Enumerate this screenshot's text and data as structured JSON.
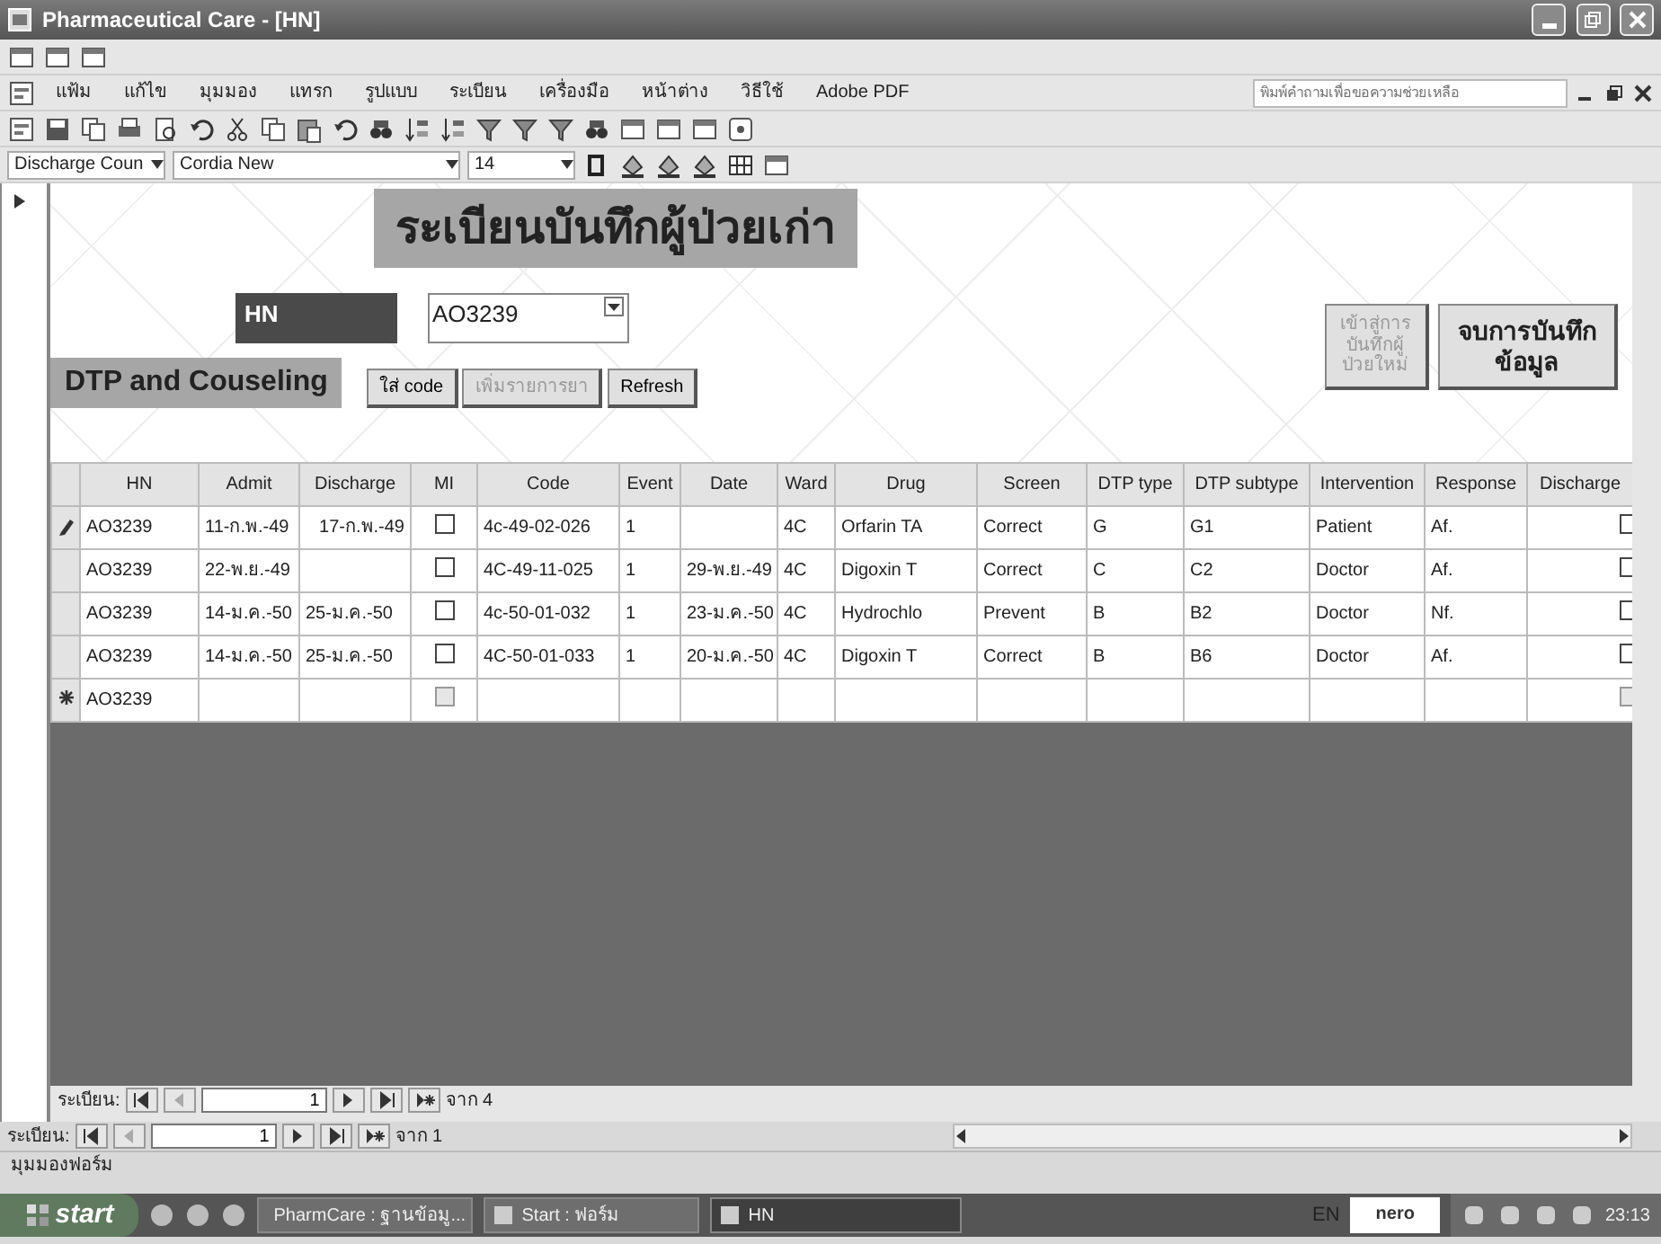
{
  "window": {
    "title": "Pharmaceutical Care - [HN]"
  },
  "menu_bar": {
    "items": [
      "แฟ้ม",
      "แก้ไข",
      "มุมมอง",
      "แทรก",
      "รูปแบบ",
      "ระเบียน",
      "เครื่องมือ",
      "หน้าต่าง",
      "วิธีใช้",
      "Adobe PDF"
    ],
    "help_box": {
      "placeholder": "พิมพ์คำถามเพื่อขอความช่วยเหลือ"
    }
  },
  "format_toolbar": {
    "object_combo": "Discharge Coun",
    "font_combo": "Cordia New",
    "size_combo": "14"
  },
  "form": {
    "title": "ระเบียนบันทึกผู้ป่วยเก่า",
    "hn_label": "HN",
    "hn_value": "AO3239",
    "section_title": "DTP and Couseling",
    "buttons": [
      {
        "label": "ใส่ code",
        "disabled": false
      },
      {
        "label": "เพิ่มรายการยา",
        "disabled": true
      },
      {
        "label": "Refresh",
        "disabled": false
      }
    ],
    "side_buttons": [
      {
        "label": "เข้าสู่การบันทึกผู้ป่วยใหม่",
        "disabled": true
      },
      {
        "label": "จบการบันทึกข้อมูล",
        "disabled": false
      }
    ],
    "table": {
      "columns": [
        "HN",
        "Admit",
        "Discharge",
        "MI",
        "Code",
        "Event",
        "Date",
        "Ward",
        "Drug",
        "Screen",
        "DTP type",
        "DTP subtype",
        "Intervention",
        "Response",
        "Discharge"
      ],
      "rows": [
        {
          "kind": "editing",
          "cells": [
            "AO3239",
            "11-ก.พ.-49",
            "17-ก.พ.-49",
            {
              "checked": false,
              "disabled": false
            },
            "4c-49-02-026",
            "1",
            null,
            "4C",
            "Orfarin TA",
            "Correct",
            "G",
            "G1",
            "Patient",
            "Af.",
            {
              "checked": false,
              "disabled": false
            }
          ]
        },
        {
          "kind": "plain",
          "cells": [
            "AO3239",
            "22-พ.ย.-49",
            null,
            {
              "checked": false,
              "disabled": false
            },
            "4C-49-11-025",
            "1",
            "29-พ.ย.-49",
            "4C",
            "Digoxin T",
            "Correct",
            "C",
            "C2",
            "Doctor",
            "Af.",
            {
              "checked": false,
              "disabled": false
            }
          ]
        },
        {
          "kind": "plain",
          "cells": [
            "AO3239",
            "14-ม.ค.-50",
            "25-ม.ค.-50",
            {
              "checked": false,
              "disabled": false
            },
            "4c-50-01-032",
            "1",
            "23-ม.ค.-50",
            "4C",
            "Hydrochlo",
            "Prevent",
            "B",
            "B2",
            "Doctor",
            "Nf.",
            {
              "checked": false,
              "disabled": false
            }
          ]
        },
        {
          "kind": "plain",
          "cells": [
            "AO3239",
            "14-ม.ค.-50",
            "25-ม.ค.-50",
            {
              "checked": false,
              "disabled": false
            },
            "4C-50-01-033",
            "1",
            "20-ม.ค.-50",
            "4C",
            "Digoxin T",
            "Correct",
            "B",
            "B6",
            "Doctor",
            "Af.",
            {
              "checked": false,
              "disabled": false
            }
          ]
        },
        {
          "kind": "new",
          "cells": [
            "AO3239",
            null,
            null,
            {
              "checked": false,
              "disabled": true
            },
            null,
            null,
            null,
            null,
            null,
            null,
            null,
            null,
            null,
            null,
            {
              "checked": false,
              "disabled": true
            }
          ]
        }
      ]
    },
    "subform_nav": {
      "label": "ระเบียน:",
      "current": "1",
      "total": "จาก 4"
    }
  },
  "form_nav": {
    "label": "ระเบียน:",
    "current": "1",
    "total": "จาก 1"
  },
  "status_bar": "มุมมองฟอร์ม",
  "taskbar": {
    "start": "start",
    "tasks": [
      {
        "label": "PharmCare : ฐานข้อมู...",
        "active": false
      },
      {
        "label": "Start : ฟอร์ม",
        "active": false
      },
      {
        "label": "HN",
        "active": true
      }
    ],
    "language": "EN",
    "tray_logo": "nero",
    "clock": "23:13"
  }
}
